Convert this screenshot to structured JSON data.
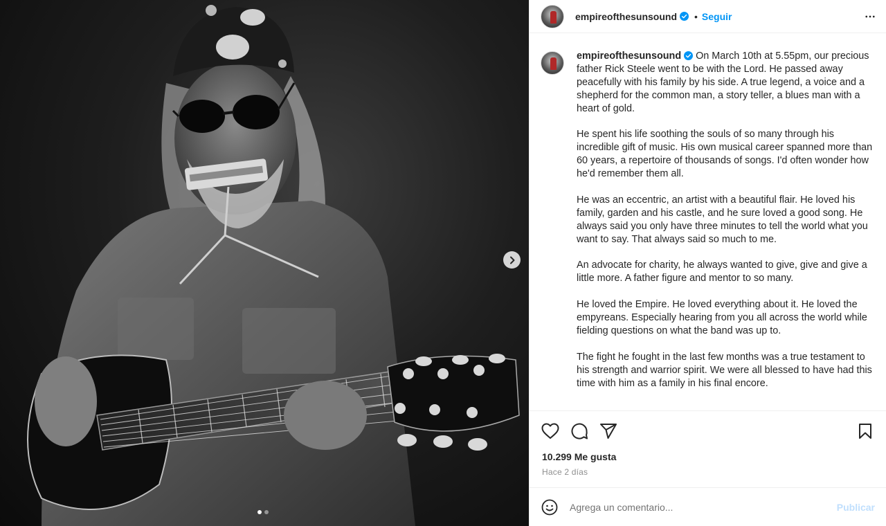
{
  "post": {
    "username": "empireofthesunsound",
    "follow_label": "Seguir",
    "separator": "•",
    "caption_paragraphs": [
      "On March 10th at 5.55pm, our precious father Rick Steele went to be with the Lord. He passed away peacefully with his family by his side. A true legend, a voice and a shepherd for the common man, a story teller, a blues man with a heart of gold.",
      "He spent his life soothing the souls of so many through his incredible gift of music. His own musical career spanned more than 60 years, a repertoire of thousands of songs. I'd often wonder how he'd remember them all.",
      "He was an eccentric, an artist with a beautiful flair. He loved his family, garden and his castle, and he sure loved a good song. He always said you only have three minutes to tell the world what you want to say. That always said so much to me.",
      "An advocate for charity, he always wanted to give, give and give a little more. A father figure and mentor to so many.",
      "He loved the Empire. He loved everything about it. He loved the empyreans. Especially hearing from you all across the world while fielding questions on what the band was up to.",
      "The fight he fought in the last few months was a true testament to his strength and warrior spirit. We were all blessed to have had this time with him as a family in his final encore."
    ],
    "likes": "10.299 Me gusta",
    "time": "Hace 2 días"
  },
  "media": {
    "carousel_total": 2,
    "carousel_active": 1,
    "photo_description_icons": [
      "bandana",
      "harmonica",
      "guitar"
    ]
  },
  "comment": {
    "placeholder": "Agrega un comentario...",
    "publish_label": "Publicar"
  },
  "colors": {
    "accent": "#0095f6",
    "publish_disabled": "#c0dffd",
    "secondary_text": "#8e8e8e",
    "verified": "#0095f6"
  },
  "icons": {
    "like": "heart-icon",
    "comment": "comment-icon",
    "share": "share-icon",
    "save": "bookmark-icon",
    "more": "more-options-icon",
    "emoji": "emoji-icon",
    "next": "chevron-right-icon"
  }
}
